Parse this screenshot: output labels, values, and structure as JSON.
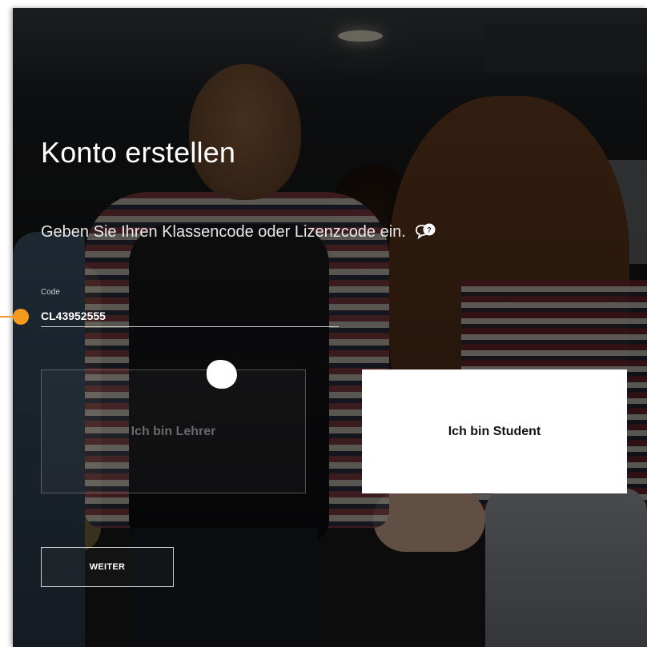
{
  "page": {
    "title": "Konto erstellen",
    "subtitle": "Geben Sie Ihren Klassencode oder Lizenzcode ein."
  },
  "code_field": {
    "label": "Code",
    "value": "CL43952555"
  },
  "roles": {
    "teacher_label": "Ich bin Lehrer",
    "student_label": "Ich bin Student",
    "selected": "student"
  },
  "actions": {
    "next_label": "WEITER"
  },
  "icons": {
    "help": "help-chat-icon"
  },
  "colors": {
    "marker": "#f39a1e",
    "selected_bg": "#ffffff",
    "text": "#ffffff"
  }
}
